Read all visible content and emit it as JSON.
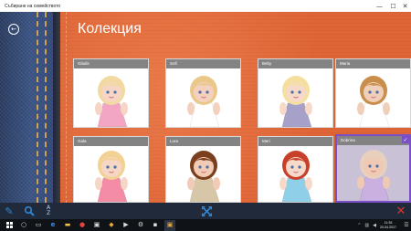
{
  "window": {
    "title": "Събиране на семейството",
    "minimize_glyph": "—",
    "maximize_glyph": "☐",
    "close_glyph": "✕"
  },
  "header": {
    "back_glyph": "←",
    "title": "Колекция"
  },
  "dolls": [
    {
      "name": "Gladis",
      "hair": "#f2d9a1",
      "dress": "#f3a6c3",
      "skin": "#f6d5c4"
    },
    {
      "name": "Sofi",
      "hair": "#e9c88a",
      "dress": "#ffffff",
      "skin": "#f4d1bf"
    },
    {
      "name": "Beby",
      "hair": "#f5df9e",
      "dress": "#a7a0c9",
      "skin": "#f7d9c8"
    },
    {
      "name": "Maria",
      "hair": "#c98f4a",
      "dress": "#ffffff",
      "skin": "#f0cfba"
    },
    {
      "name": "Gala",
      "hair": "#f2d192",
      "dress": "#f58ca6",
      "skin": "#f6d6c5"
    },
    {
      "name": "Lora",
      "hair": "#7a3f1c",
      "dress": "#d8c6a8",
      "skin": "#f2cbb6"
    },
    {
      "name": "Meri",
      "hair": "#c8402a",
      "dress": "#8fd0e8",
      "skin": "#f6d9c9"
    },
    {
      "name": "Dobrina",
      "hair": "#e7d1be",
      "dress": "#c9b0e0",
      "skin": "#f0c9b4"
    }
  ],
  "selected_doll": "Dobrina",
  "appbar": {
    "pencil_icon": "pencil-icon",
    "search_icon": "search-icon",
    "sort_icon": "sort-az-icon",
    "sort_top": "A",
    "sort_bottom": "Z",
    "resize_icon": "resize-icon",
    "close_icon": "close-icon"
  },
  "taskbar": {
    "clock_time": "11:35",
    "clock_date": "20.04.2017"
  },
  "colors": {
    "accent_blue": "#2f86d6",
    "close_red": "#e0342c",
    "selection_purple": "#7b4fc6",
    "leather": "#df6536",
    "appbar_bg": "#202a3a"
  }
}
